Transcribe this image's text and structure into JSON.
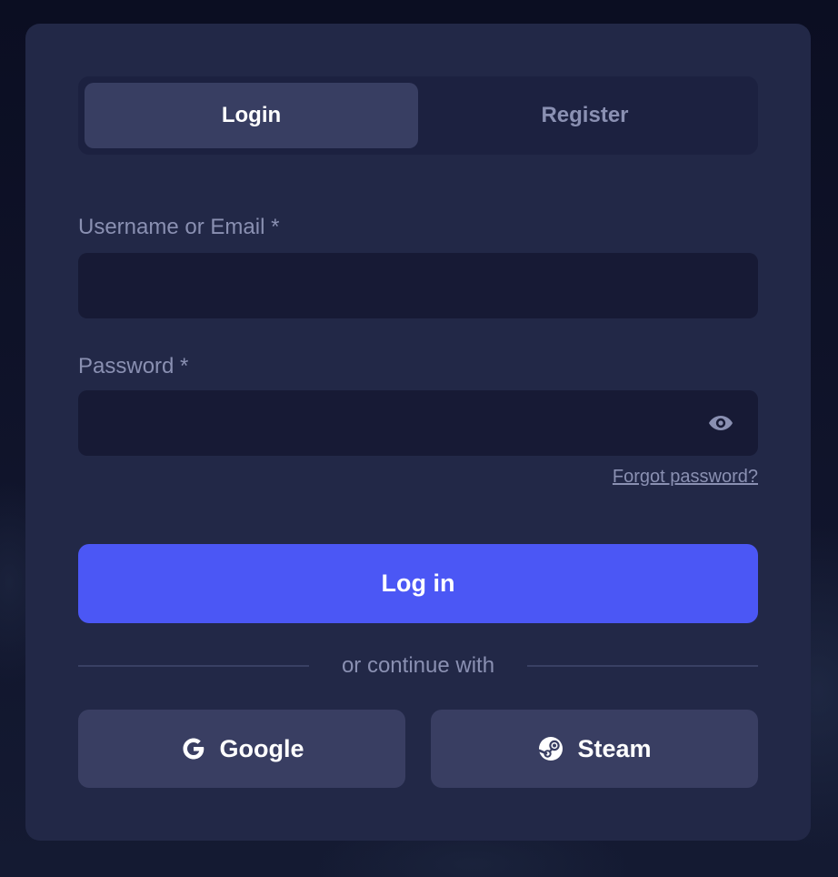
{
  "tabs": [
    {
      "label": "Login",
      "active": true
    },
    {
      "label": "Register",
      "active": false
    }
  ],
  "form": {
    "username_label": "Username or Email *",
    "username_value": "",
    "password_label": "Password *",
    "password_value": "",
    "show_password_icon": "eye-icon",
    "forgot_link": "Forgot password?",
    "submit_label": "Log in"
  },
  "divider": {
    "text": "or continue with"
  },
  "social": {
    "google_label": "Google",
    "google_icon": "google-icon",
    "steam_label": "Steam",
    "steam_icon": "steam-icon"
  },
  "colors": {
    "background": "#0e1126",
    "card": "#222847",
    "accent": "#4b57f5",
    "muted_text": "#8a90b2"
  }
}
